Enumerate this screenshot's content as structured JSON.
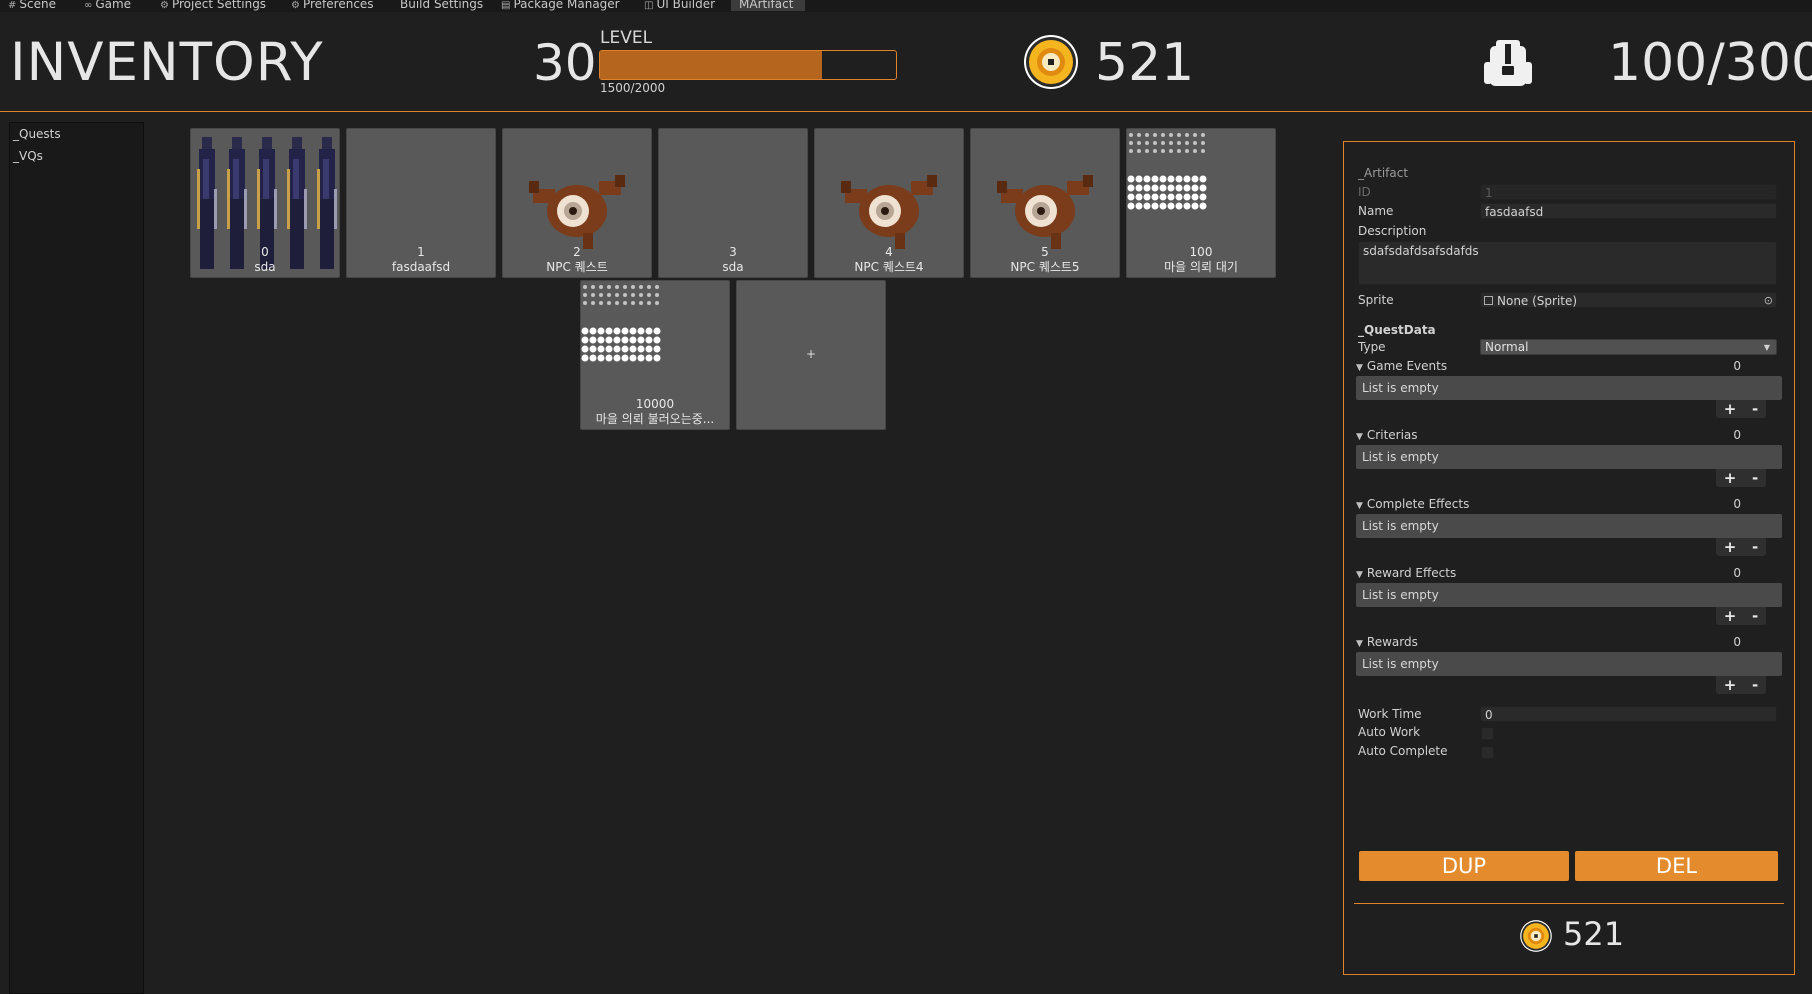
{
  "tabs": [
    {
      "icon": "#",
      "label": "Scene"
    },
    {
      "icon": "∞",
      "label": "Game"
    },
    {
      "icon": "⚙",
      "label": "Project Settings"
    },
    {
      "icon": "⚙",
      "label": "Preferences"
    },
    {
      "icon": "",
      "label": "Build Settings"
    },
    {
      "icon": "▤",
      "label": "Package Manager"
    },
    {
      "icon": "◫",
      "label": "UI Builder"
    },
    {
      "icon": "",
      "label": "MArtifact"
    }
  ],
  "header": {
    "title": "INVENTORY",
    "level": "30",
    "level_label": "LEVEL",
    "xp_text": "1500/2000",
    "xp_fraction": 0.75,
    "coins": "521",
    "capacity": "100/300"
  },
  "sidebar": {
    "items": [
      "_Quests",
      "_VQs"
    ]
  },
  "cards": [
    {
      "id": "0",
      "name": "sda",
      "sprite": "knights"
    },
    {
      "id": "1",
      "name": "fasdaafsd",
      "sprite": ""
    },
    {
      "id": "2",
      "name": "NPC 퀘스트",
      "sprite": "creature"
    },
    {
      "id": "3",
      "name": "sda",
      "sprite": ""
    },
    {
      "id": "4",
      "name": "NPC 퀘스트4",
      "sprite": "creature"
    },
    {
      "id": "5",
      "name": "NPC 퀘스트5",
      "sprite": "creature"
    },
    {
      "id": "100",
      "name": "마을 의뢰 대기",
      "sprite": "dots"
    },
    {
      "id": "10000",
      "name": "마을 의뢰 불러오는중...",
      "sprite": "dots"
    }
  ],
  "add_card_label": "+",
  "panel": {
    "artifact_heading": "_Artifact",
    "id_label": "ID",
    "id_value": "1",
    "name_label": "Name",
    "name_value": "fasdaafsd",
    "description_label": "Description",
    "description_value": "sdafsdafdsafsdafds",
    "sprite_label": "Sprite",
    "sprite_value": "None (Sprite)",
    "questdata_heading": "_QuestData",
    "type_label": "Type",
    "type_value": "Normal",
    "lists": [
      {
        "label": "Game Events",
        "count": "0",
        "empty_text": "List is empty"
      },
      {
        "label": "Criterias",
        "count": "0",
        "empty_text": "List is empty"
      },
      {
        "label": "Complete Effects",
        "count": "0",
        "empty_text": "List is empty"
      },
      {
        "label": "Reward Effects",
        "count": "0",
        "empty_text": "List is empty"
      },
      {
        "label": "Rewards",
        "count": "0",
        "empty_text": "List is empty"
      }
    ],
    "plus": "+",
    "minus": "-",
    "work_time_label": "Work Time",
    "work_time_value": "0",
    "auto_work_label": "Auto Work",
    "auto_complete_label": "Auto Complete",
    "dup_label": "DUP",
    "del_label": "DEL",
    "coins": "521"
  },
  "colors": {
    "accent": "#e0822a",
    "button": "#e38b2d",
    "card": "#595959",
    "bar_fill": "#b5651d"
  }
}
